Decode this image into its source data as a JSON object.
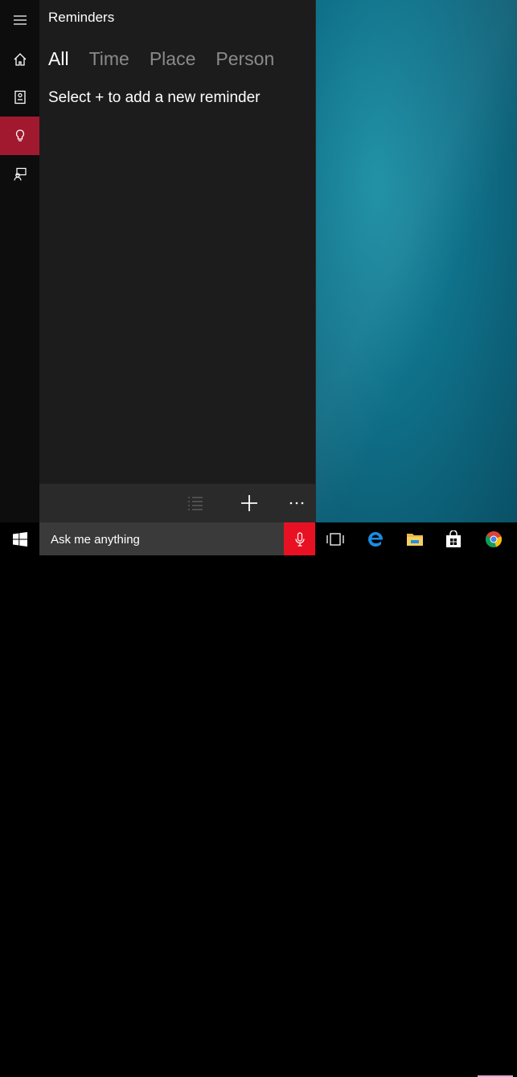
{
  "cortana": {
    "title": "Reminders",
    "tabs": [
      {
        "label": "All",
        "active": true
      },
      {
        "label": "Time",
        "active": false
      },
      {
        "label": "Place",
        "active": false
      },
      {
        "label": "Person",
        "active": false
      }
    ],
    "hint": "Select + to add a new reminder",
    "rail": [
      {
        "icon": "hamburger-menu-icon"
      },
      {
        "icon": "home-icon"
      },
      {
        "icon": "notebook-icon"
      },
      {
        "icon": "lightbulb-icon",
        "active": true
      },
      {
        "icon": "feedback-icon"
      }
    ],
    "bottom_bar": [
      "list-icon",
      "plus-icon",
      "more-icon"
    ]
  },
  "taskbar": {
    "search_placeholder": "Ask me anything",
    "icons": [
      "windows-logo-icon",
      "microphone-icon",
      "task-view-icon",
      "edge-icon",
      "file-explorer-icon",
      "store-icon",
      "chrome-icon"
    ]
  },
  "colors": {
    "accent": "#a1192e",
    "mic": "#e81123",
    "panel": "#1c1c1c",
    "rail": "#0d0d0d",
    "wallpaper": "#0f7189"
  }
}
